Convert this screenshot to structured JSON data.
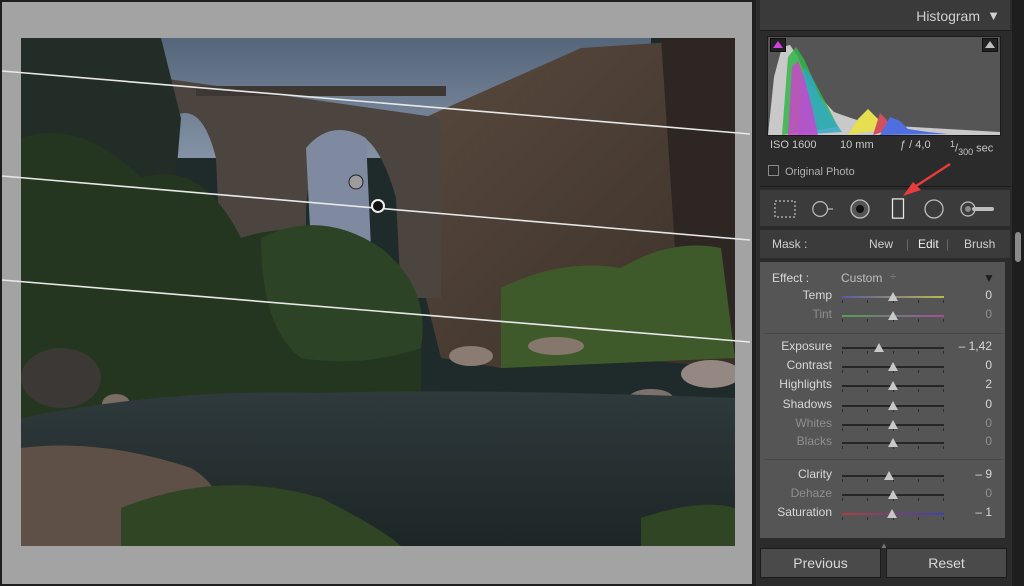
{
  "histogram": {
    "title": "Histogram",
    "iso": "ISO 1600",
    "focal": "10 mm",
    "aperture": "ƒ / 4,0",
    "shutter_num": "1",
    "shutter_den": "300",
    "shutter_unit": "sec",
    "original_photo": "Original Photo"
  },
  "tools": [
    "crop-overlay-icon",
    "spot-removal-icon",
    "red-eye-icon",
    "graduated-filter-icon",
    "radial-filter-icon",
    "adjustment-brush-icon"
  ],
  "mask": {
    "label": "Mask :",
    "new": "New",
    "edit": "Edit",
    "separator": "|",
    "brush": "Brush"
  },
  "effect": {
    "label": "Effect :",
    "value": "Custom",
    "stepper": "÷",
    "menu_glyph": "▼"
  },
  "sliders": [
    {
      "label": "Temp",
      "value": "0",
      "pos": 0.5
    },
    {
      "label": "Tint",
      "value": "0",
      "pos": 0.5
    },
    {
      "label": "Exposure",
      "value": "– 1,42",
      "pos": 0.36
    },
    {
      "label": "Contrast",
      "value": "0",
      "pos": 0.5
    },
    {
      "label": "Highlights",
      "value": "2",
      "pos": 0.5
    },
    {
      "label": "Shadows",
      "value": "0",
      "pos": 0.5
    },
    {
      "label": "Whites",
      "value": "0",
      "pos": 0.5
    },
    {
      "label": "Blacks",
      "value": "0",
      "pos": 0.5
    },
    {
      "label": "Clarity",
      "value": "– 9",
      "pos": 0.46
    },
    {
      "label": "Dehaze",
      "value": "0",
      "pos": 0.5
    },
    {
      "label": "Saturation",
      "value": "– 1",
      "pos": 0.49
    }
  ],
  "buttons": {
    "previous": "Previous",
    "reset": "Reset"
  },
  "colors": {
    "annotation_arrow": "#e83c3c",
    "temp_gradient": [
      "#5a5aa0",
      "#b8b850"
    ],
    "tint_gradient": [
      "#50a050",
      "#a050a0"
    ],
    "saturation_gradient": [
      "#b04040",
      "#4040b0"
    ]
  }
}
